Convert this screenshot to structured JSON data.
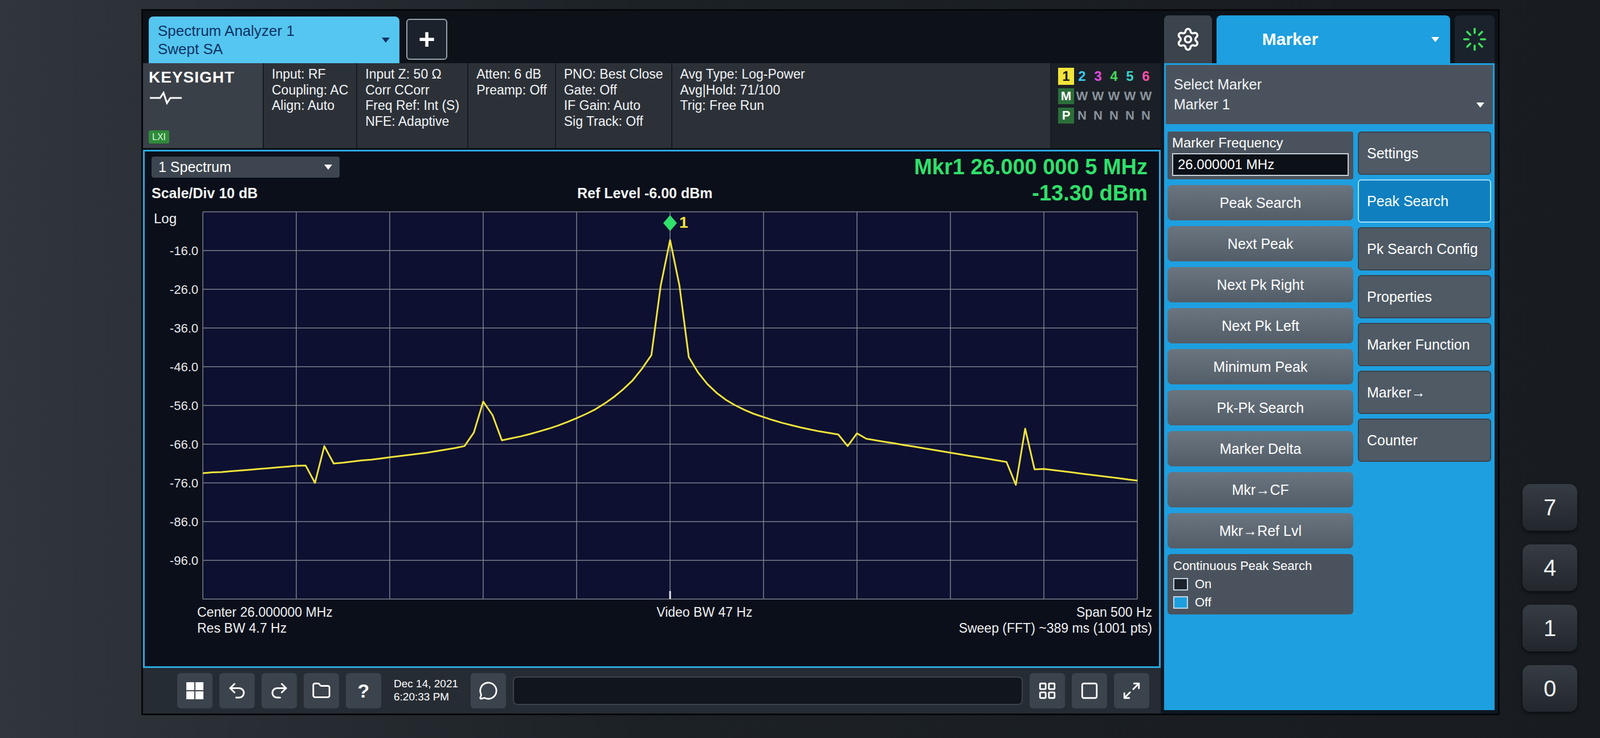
{
  "window": {
    "title": "Spectrum Analyzer 1",
    "subtitle": "Swept SA",
    "add_button": "+"
  },
  "instrument": {
    "brand": "KEYSIGHT",
    "badge": "LXI"
  },
  "settings": [
    {
      "lines": [
        "Input: RF",
        "Coupling: AC",
        "Align: Auto"
      ]
    },
    {
      "lines": [
        "Input Z: 50 Ω",
        "Corr CCorr",
        "Freq Ref: Int (S)",
        "NFE: Adaptive"
      ]
    },
    {
      "lines": [
        "Atten: 6 dB",
        "Preamp: Off"
      ]
    },
    {
      "lines": [
        "PNO: Best Close",
        "Gate: Off",
        "IF Gain: Auto",
        "Sig Track: Off"
      ]
    },
    {
      "lines": [
        "Avg Type: Log-Power",
        "Avg|Hold: 71/100",
        "Trig: Free Run"
      ]
    }
  ],
  "traces": [
    {
      "number": "1",
      "type": "M",
      "detector": "P",
      "color": "#f2e43a",
      "selected": true
    },
    {
      "number": "2",
      "type": "W",
      "detector": "N",
      "color": "#3cc8f0",
      "selected": false
    },
    {
      "number": "3",
      "type": "W",
      "detector": "N",
      "color": "#e04ce0",
      "selected": false
    },
    {
      "number": "4",
      "type": "W",
      "detector": "N",
      "color": "#45d75a",
      "selected": false
    },
    {
      "number": "5",
      "type": "W",
      "detector": "N",
      "color": "#3ad0c8",
      "selected": false
    },
    {
      "number": "6",
      "type": "W",
      "detector": "N",
      "color": "#ff4fa8",
      "selected": false
    }
  ],
  "chart": {
    "window_label": "1 Spectrum",
    "marker_frequency": "Mkr1  26.000 000 5 MHz",
    "marker_level": "-13.30 dBm",
    "scale": "Scale/Div 10 dB",
    "ref_level": "Ref Level -6.00 dBm",
    "scale_type": "Log",
    "y_range": [
      -106,
      -6
    ],
    "y_ticks": [
      "-16.0",
      "-26.0",
      "-36.0",
      "-46.0",
      "-56.0",
      "-66.0",
      "-76.0",
      "-86.0",
      "-96.0"
    ],
    "center": "Center 26.000000 MHz",
    "res_bw": "Res BW 4.7 Hz",
    "video_bw": "Video BW 47 Hz",
    "span": "Span 500 Hz",
    "sweep": "Sweep (FFT) ~389 ms (1001 pts)",
    "marker": {
      "label": "1",
      "point": 50
    },
    "series": [
      {
        "name": "Trace 1",
        "values": [
          -73.5,
          -73.3,
          -73.2,
          -73.0,
          -72.8,
          -72.6,
          -72.4,
          -72.2,
          -72.0,
          -71.8,
          -71.6,
          -71.5,
          -76.0,
          -66.5,
          -71.0,
          -70.8,
          -70.5,
          -70.2,
          -70.0,
          -69.7,
          -69.4,
          -69.1,
          -68.8,
          -68.5,
          -68.2,
          -67.8,
          -67.4,
          -67.0,
          -66.5,
          -63.0,
          -55.0,
          -58.5,
          -65.0,
          -64.5,
          -64.0,
          -63.4,
          -62.7,
          -62.0,
          -61.2,
          -60.3,
          -59.3,
          -58.2,
          -57.0,
          -55.5,
          -53.8,
          -51.8,
          -49.5,
          -46.5,
          -43.0,
          -25.0,
          -13.3,
          -25.0,
          -43.5,
          -47.5,
          -50.5,
          -52.8,
          -54.6,
          -56.0,
          -57.2,
          -58.2,
          -59.0,
          -59.8,
          -60.5,
          -61.1,
          -61.7,
          -62.2,
          -62.7,
          -63.1,
          -63.5,
          -66.5,
          -63.2,
          -64.6,
          -65.0,
          -65.4,
          -65.8,
          -66.2,
          -66.6,
          -67.0,
          -67.4,
          -67.8,
          -68.2,
          -68.6,
          -69.0,
          -69.4,
          -69.8,
          -70.2,
          -70.6,
          -76.5,
          -62.0,
          -72.5,
          -72.4,
          -72.7,
          -73.0,
          -73.3,
          -73.6,
          -73.9,
          -74.2,
          -74.5,
          -74.8,
          -75.1,
          -75.4
        ]
      }
    ]
  },
  "menu": {
    "title": "Marker",
    "select_label": "Select Marker",
    "select_value": "Marker 1",
    "frequency_label": "Marker Frequency",
    "frequency_value": "26.000001 MHz",
    "buttons": [
      "Peak Search",
      "Next Peak",
      "Next Pk Right",
      "Next Pk Left",
      "Minimum Peak",
      "Pk-Pk Search",
      "Marker Delta",
      "Mkr→CF",
      "Mkr→Ref Lvl"
    ],
    "continuous": {
      "label": "Continuous Peak Search",
      "options": [
        {
          "label": "On",
          "selected": false
        },
        {
          "label": "Off",
          "selected": true
        }
      ]
    }
  },
  "side_tabs": [
    {
      "label": "Settings",
      "selected": false
    },
    {
      "label": "Peak Search",
      "selected": true
    },
    {
      "label": "Pk Search Config",
      "selected": false
    },
    {
      "label": "Properties",
      "selected": false
    },
    {
      "label": "Marker Function",
      "selected": false
    },
    {
      "label": "Marker→",
      "selected": false
    },
    {
      "label": "Counter",
      "selected": false
    }
  ],
  "taskbar": {
    "help": "?",
    "date": "Dec 14, 2021",
    "time": "6:20:33 PM"
  },
  "keypad": [
    "7",
    "4",
    "1",
    "0"
  ]
}
